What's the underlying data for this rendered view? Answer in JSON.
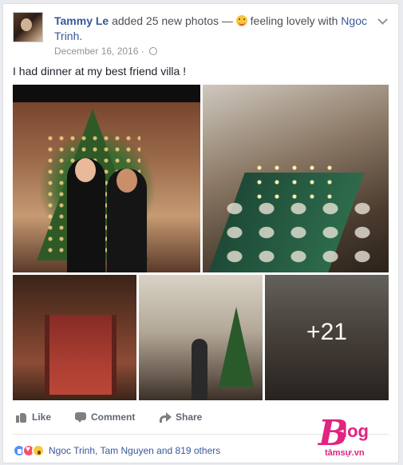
{
  "post": {
    "author": "Tammy Le",
    "headline_action": "added 25 new photos —",
    "feeling": "feeling lovely with",
    "tagged": "Ngoc Trinh.",
    "date": "December 16, 2016",
    "separator": "·",
    "status_text": "I had dinner at my best friend villa !",
    "more_photos_count": "+21"
  },
  "actions": {
    "like": "Like",
    "comment": "Comment",
    "share": "Share"
  },
  "reactions": {
    "summary": "Ngoc Trinh, Tam Nguyen and 819 others"
  },
  "watermark": {
    "brand_letter": "B",
    "brand_rest": "log",
    "sub": "tâmsự.vn",
    "color": "#e2237f"
  },
  "colors": {
    "link": "#365899",
    "meta": "#90949c",
    "action": "#616770"
  },
  "icons": [
    "emoji-lovely-icon",
    "globe-icon",
    "chevron-down-icon",
    "like-icon",
    "comment-icon",
    "share-icon",
    "reaction-like-icon",
    "reaction-love-icon",
    "reaction-wow-icon"
  ]
}
